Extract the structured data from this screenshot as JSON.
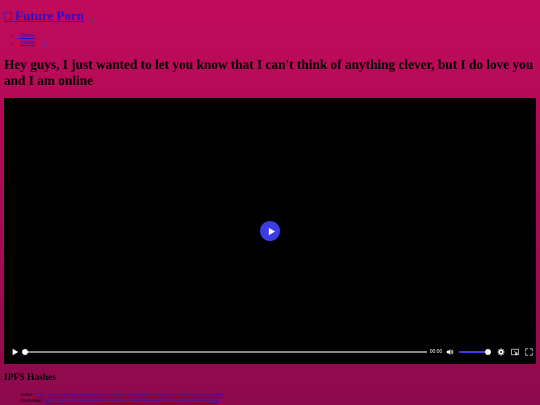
{
  "site": {
    "logo_glyph": "□",
    "title": "Future Porn"
  },
  "nav": {
    "items": [
      {
        "label": "Home"
      },
      {
        "label": "About"
      }
    ]
  },
  "post": {
    "title": "Hey guys, I just wanted to let you know that I can't think of anything clever, but I do love you and I am online"
  },
  "player": {
    "time": "00:00",
    "progress": 0,
    "volume": 1,
    "accent_color": "#3c3ce6"
  },
  "ipfs": {
    "heading": "IPFS Hashes",
    "items": [
      {
        "label": "Video:",
        "hash": "https://ipfs.io/ipfs/QmYbWu8hE9kFqVfQ2zLhGm7PRrX3a1dKcN5tTvUoBj6sHe/video.mp4"
      },
      {
        "label": "Thumbnail:",
        "hash": "https://ipfs.io/ipfs/QmThumbA7cK9pLx2VwR4nD8eF1sG3hJ5mQ6uY0zB/thumb.jpg"
      }
    ]
  }
}
